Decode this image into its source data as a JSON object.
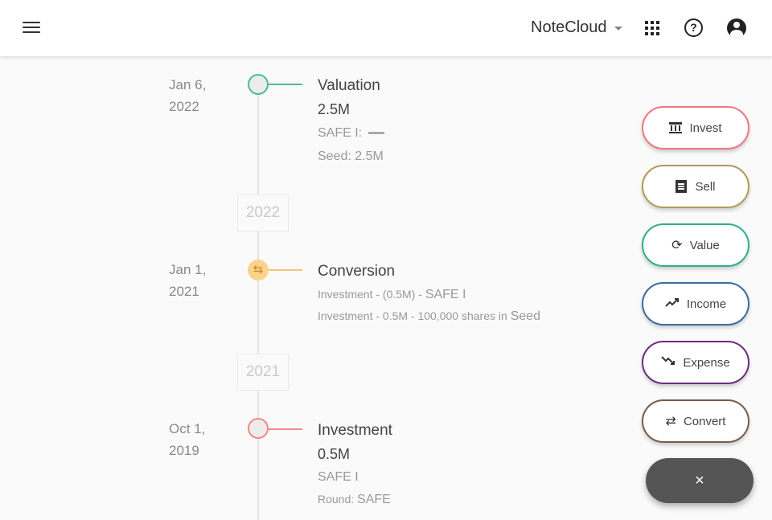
{
  "header": {
    "brand": "NoteCloud",
    "icons": [
      "menu-icon",
      "apps-grid-icon",
      "help-icon",
      "account-circle-icon"
    ]
  },
  "timeline": {
    "years": [
      "2022",
      "2021"
    ],
    "events": [
      {
        "date_line1": "Jan 6,",
        "date_line2": "2022",
        "title": "Valuation",
        "amount": "2.5M",
        "line1": "SAFE I:",
        "line2": "Seed: 2.5M",
        "color": "#4dbb9c"
      },
      {
        "date_line1": "Jan 1,",
        "date_line2": "2021",
        "title": "Conversion",
        "line1_pre": "Investment - (0.5M) - ",
        "line1_post": "SAFE I",
        "line2_pre": "Investment - 0.5M - 100,000 shares in ",
        "line2_post": "Seed",
        "color": "#f6c27a"
      },
      {
        "date_line1": "Oct 1,",
        "date_line2": "2019",
        "title": "Investment",
        "amount": "0.5M",
        "line1": "SAFE I",
        "line2_pre": "Round: ",
        "line2_post": "SAFE",
        "color": "#ee8a8a"
      }
    ]
  },
  "actions": [
    {
      "label": "Invest",
      "icon": "bank-icon",
      "color": "#ea7a7f"
    },
    {
      "label": "Sell",
      "icon": "receipt-icon",
      "color": "#b39a55"
    },
    {
      "label": "Value",
      "icon": "sync-icon",
      "color": "#2fae8f"
    },
    {
      "label": "Income",
      "icon": "trending-up-icon",
      "color": "#3c6b9e"
    },
    {
      "label": "Expense",
      "icon": "trending-down-icon",
      "color": "#6b2d7e"
    },
    {
      "label": "Convert",
      "icon": "swap-icon",
      "color": "#7a5a4a"
    }
  ],
  "close_label": "×"
}
